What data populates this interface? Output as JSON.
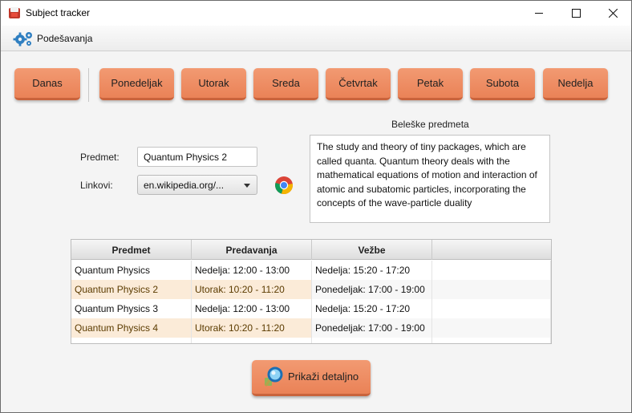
{
  "window": {
    "title": "Subject tracker"
  },
  "menu": {
    "settings_label": "Podešavanja"
  },
  "days": [
    "Danas",
    "Ponedeljak",
    "Utorak",
    "Sreda",
    "Četvrtak",
    "Petak",
    "Subota",
    "Nedelja"
  ],
  "form": {
    "subject_label": "Predmet:",
    "subject_value": "Quantum Physics 2",
    "links_label": "Linkovi:",
    "links_selected": "en.wikipedia.org/..."
  },
  "notes": {
    "title": "Beleške predmeta",
    "text": "The study and theory of tiny packages, which are called quanta. Quantum theory deals with the mathematical equations of motion and interaction of atomic and subatomic particles, incorporating the concepts of the wave-particle duality"
  },
  "table": {
    "headers": [
      "Predmet",
      "Predavanja",
      "Vežbe",
      ""
    ],
    "rows": [
      [
        "Quantum Physics",
        "Nedelja: 12:00 - 13:00",
        "Nedelja: 15:20 - 17:20"
      ],
      [
        "Quantum Physics 2",
        "Utorak: 10:20 - 11:20",
        "Ponedeljak: 17:00 - 19:00"
      ],
      [
        "Quantum Physics 3",
        "Nedelja: 12:00 - 13:00",
        "Nedelja: 15:20 - 17:20"
      ],
      [
        "Quantum Physics 4",
        "Utorak: 10:20 - 11:20",
        "Ponedeljak: 17:00 - 19:00"
      ]
    ]
  },
  "actions": {
    "details_label": "Prikaži detaljno"
  },
  "colors": {
    "accent": "#ea8257",
    "highlight_row": "#fbebd8"
  },
  "icons": [
    "app-icon",
    "gear-icon",
    "chrome-icon",
    "magnifier-icon",
    "minimize-icon",
    "maximize-icon",
    "close-icon"
  ]
}
